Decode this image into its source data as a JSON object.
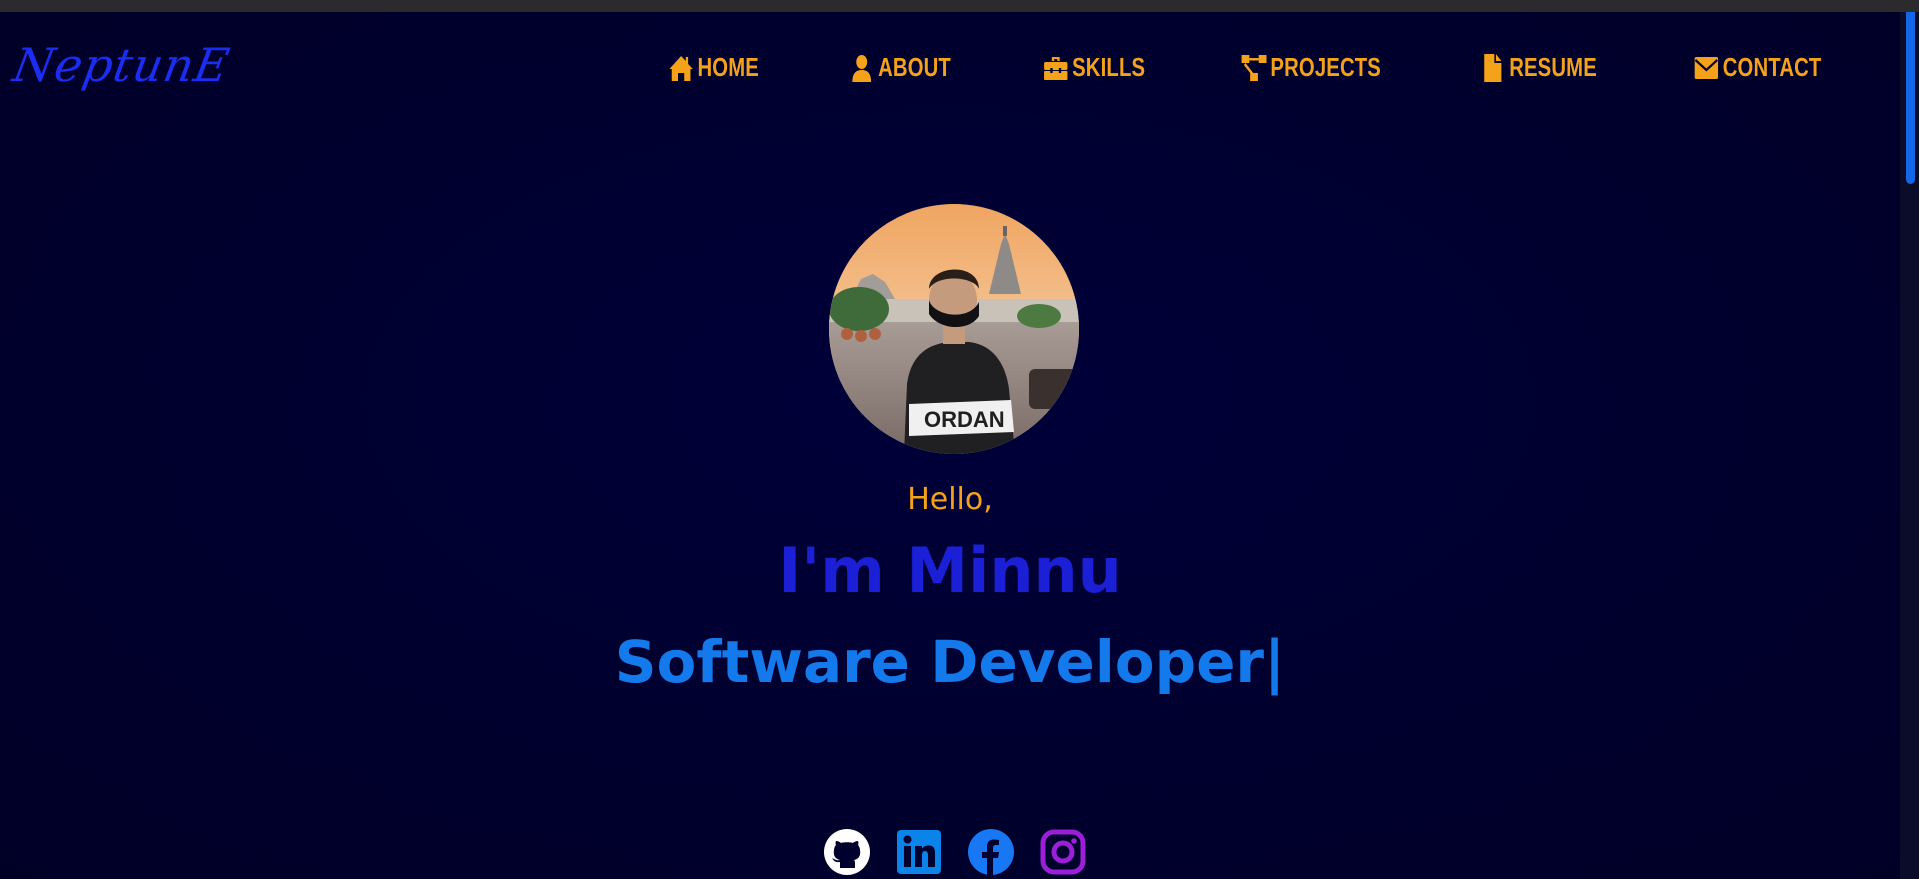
{
  "header": {
    "logo": "NeptunE"
  },
  "nav": {
    "items": [
      {
        "label": "Home",
        "icon": "home-icon"
      },
      {
        "label": "About",
        "icon": "user-icon"
      },
      {
        "label": "Skills",
        "icon": "toolbox-icon"
      },
      {
        "label": "Projects",
        "icon": "project-diagram-icon"
      },
      {
        "label": "Resume",
        "icon": "file-icon"
      },
      {
        "label": "Contact",
        "icon": "envelope-icon"
      }
    ]
  },
  "hero": {
    "greeting": "Hello,",
    "name": "I'm Minnu",
    "role": "Software Developer|"
  },
  "socials": [
    {
      "icon": "github-icon",
      "color": "#ffffff"
    },
    {
      "icon": "linkedin-icon",
      "color": "#0a84e8"
    },
    {
      "icon": "facebook-icon",
      "color": "#1877f2"
    },
    {
      "icon": "instagram-icon",
      "color": "#9b1fd6"
    }
  ],
  "colors": {
    "background": "#00002e",
    "accent": "#f5a21b",
    "name": "#1b1fd6",
    "role": "#1479ea",
    "logo": "#1a2df0"
  }
}
